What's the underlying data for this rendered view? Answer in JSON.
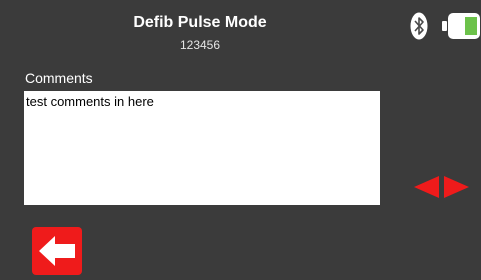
{
  "header": {
    "title": "Defib Pulse Mode",
    "subtitle": "123456"
  },
  "status": {
    "bluetooth_icon": "bluetooth-icon",
    "battery_icon": "battery-icon",
    "battery_level": 0.45,
    "battery_color": "#6cc24a"
  },
  "comments": {
    "label": "Comments",
    "value": "test comments in here"
  },
  "navigation": {
    "arrows_icon": "left-right-arrows-icon",
    "back_icon": "back-arrow-icon",
    "accent_color": "#ef1b1b"
  }
}
